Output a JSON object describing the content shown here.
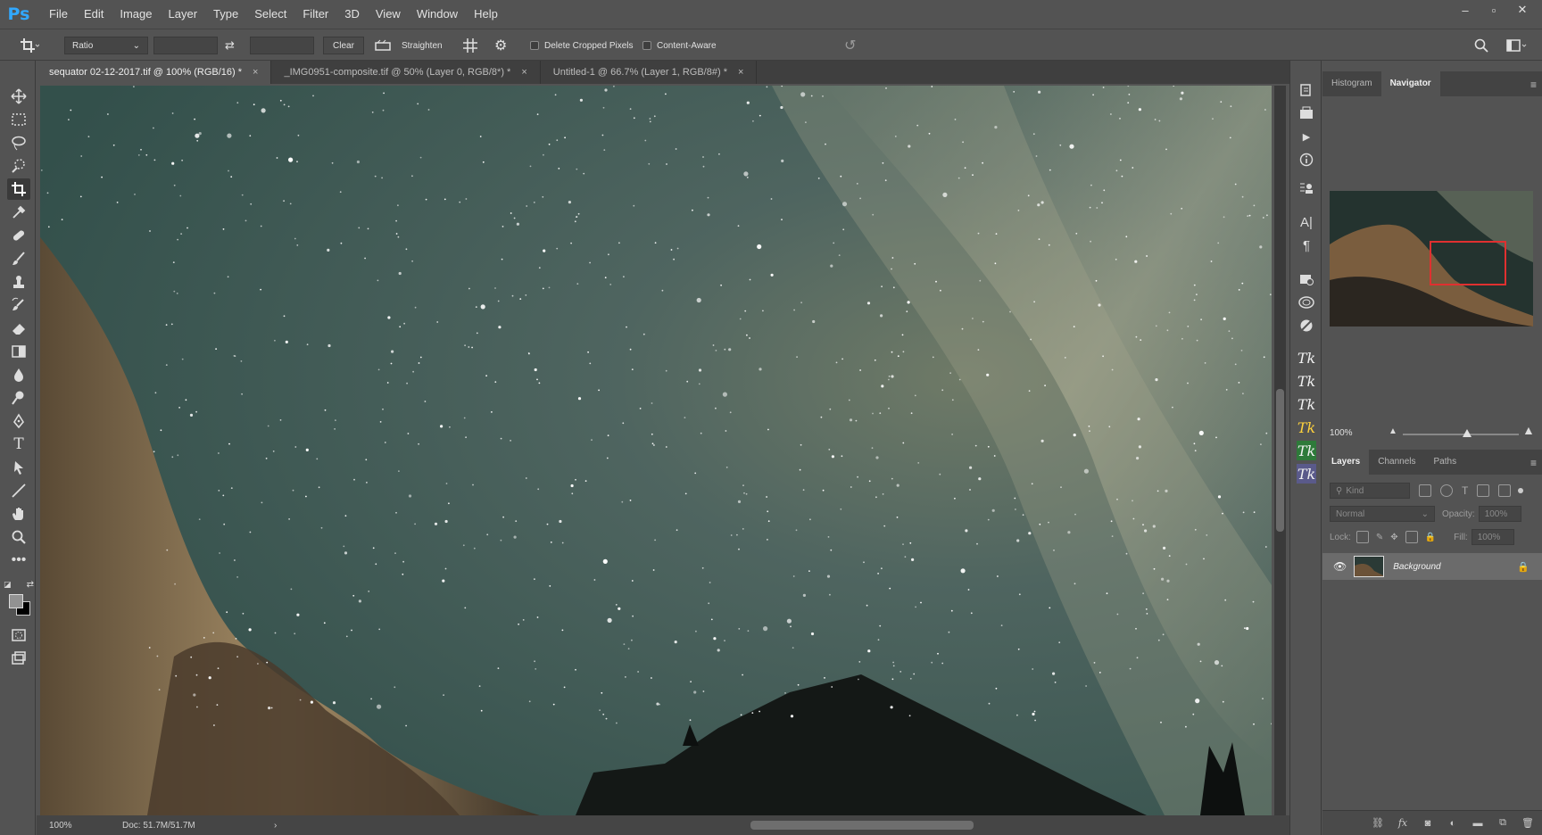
{
  "app": {
    "logo": "Ps"
  },
  "menu": [
    "File",
    "Edit",
    "Image",
    "Layer",
    "Type",
    "Select",
    "Filter",
    "3D",
    "View",
    "Window",
    "Help"
  ],
  "window_controls": {
    "minimize": "–",
    "restore": "▫",
    "close": "✕"
  },
  "options": {
    "ratio_value": "Ratio",
    "clear_label": "Clear",
    "straighten_label": "Straighten",
    "delete_cropped_label": "Delete Cropped Pixels",
    "content_aware_label": "Content-Aware",
    "delete_cropped_checked": false,
    "content_aware_checked": false
  },
  "tabs": [
    {
      "label": "sequator 02-12-2017.tif @ 100% (RGB/16) *",
      "active": true
    },
    {
      "label": "_IMG0951-composite.tif @ 50% (Layer 0, RGB/8*) *",
      "active": false
    },
    {
      "label": "Untitled-1 @ 66.7% (Layer 1, RGB/8#) *",
      "active": false
    }
  ],
  "tab_close": "×",
  "status": {
    "zoom": "100%",
    "doc": "Doc: 51.7M/51.7M",
    "arrow": "›"
  },
  "navigator": {
    "tabs": [
      "Histogram",
      "Navigator"
    ],
    "active_tab": "Navigator",
    "zoom": "100%",
    "zoom_level": 0.55
  },
  "layers": {
    "tabs": [
      "Layers",
      "Channels",
      "Paths"
    ],
    "active_tab": "Layers",
    "kind_placeholder": "Kind",
    "blend_mode": "Normal",
    "opacity_label": "Opacity:",
    "opacity_value": "100%",
    "lock_label": "Lock:",
    "fill_label": "Fill:",
    "fill_value": "100%",
    "items": [
      {
        "name": "Background",
        "visible": true,
        "locked": true
      }
    ]
  },
  "iconstrip": {
    "tk_label": "Tk"
  },
  "colors": {
    "accent_ps": "#31a8ff",
    "nav_rect": "#e03030",
    "panel_bg": "#535353"
  }
}
